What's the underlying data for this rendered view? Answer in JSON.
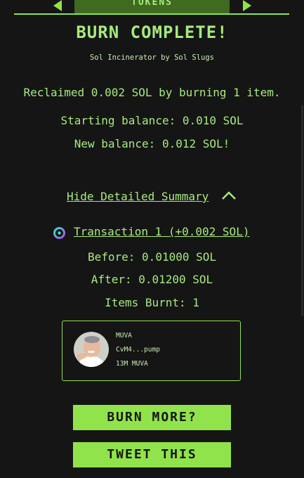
{
  "nav": {
    "tab_label": "TOKENS",
    "prev_icon": "arrow-left-icon",
    "next_icon": "arrow-right-icon"
  },
  "header": {
    "title": "BURN COMPLETE!",
    "subtitle": "Sol Incinerator by Sol Slugs"
  },
  "summary": {
    "reclaimed": "Reclaimed 0.002 SOL by burning 1 item.",
    "starting_balance": "Starting balance: 0.010 SOL",
    "new_balance": "New balance: 0.012 SOL!",
    "toggle_label": "Hide Detailed Summary",
    "toggle_icon": "chevron-up-icon"
  },
  "transaction": {
    "icon": "solana-scan-icon",
    "label": "Transaction 1 (+0.002 SOL)",
    "before": "Before: 0.01000 SOL",
    "after": "After: 0.01200 SOL",
    "items_burnt": "Items Burnt: 1"
  },
  "item": {
    "name": "MUVA",
    "mint": "CvM4...pump",
    "amount": "13M MUVA"
  },
  "actions": {
    "burn_more": "BURN MORE?",
    "tweet": "TWEET THIS"
  },
  "colors": {
    "background": "#151515",
    "accent": "#91e34b",
    "text": "#a6ea7e",
    "tab_bg": "#3f6a1f"
  }
}
